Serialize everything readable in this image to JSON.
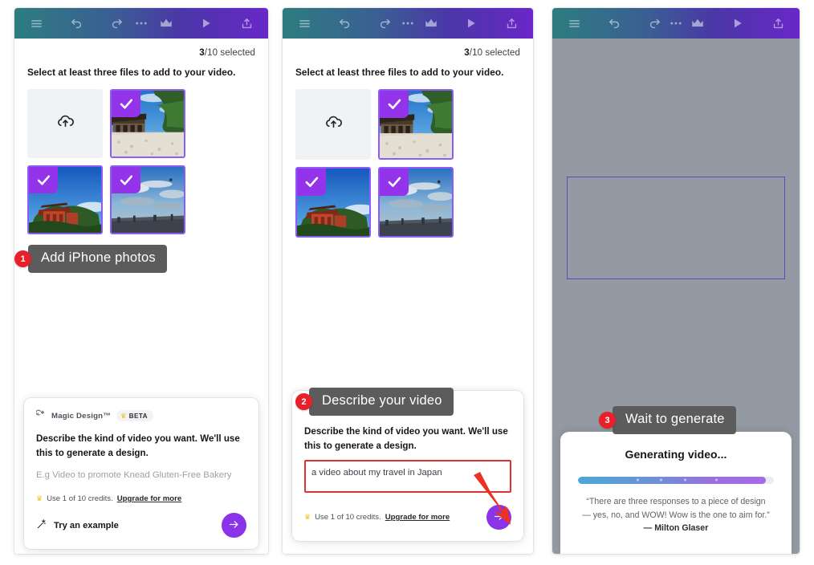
{
  "toolbar": {
    "icons": [
      {
        "name": "menu-icon",
        "label": "Menu"
      },
      {
        "name": "undo-icon",
        "label": "Undo"
      },
      {
        "name": "redo-icon",
        "label": "Redo"
      },
      {
        "name": "more-options-icon",
        "label": "More"
      },
      {
        "name": "crown-icon",
        "label": "Pro"
      },
      {
        "name": "play-icon",
        "label": "Play"
      },
      {
        "name": "share-icon",
        "label": "Share"
      }
    ]
  },
  "selection": {
    "count": "3",
    "count_suffix": "/10 selected",
    "hint": "Select at least three files to add to your video.",
    "upload_icon": "cloud-upload-icon",
    "photos": [
      {
        "name": "photo-japanese-temple",
        "selected": true
      },
      {
        "name": "photo-red-shrine-gate",
        "selected": true
      },
      {
        "name": "photo-cloudy-city-sky",
        "selected": true
      }
    ]
  },
  "magic": {
    "brand": "Magic Design™",
    "badge": "BETA",
    "badge_icon": "crown-icon",
    "brand_icon": "magic-sparkle-icon",
    "description": "Describe the kind of video you want. We'll use this to generate a design.",
    "placeholder": "E.g Video to promote Knead Gluten-Free Bakery",
    "value": "a video about my travel in Japan",
    "credits_prefix": "Use 1 of 10 credits.",
    "credits_link": "Upgrade for more",
    "credits_icon": "crown-icon",
    "try_example": "Try an example",
    "try_example_icon": "sparkle-wand-icon",
    "submit_icon": "arrow-right-icon"
  },
  "generating": {
    "title": "Generating video...",
    "progress_percent": 96,
    "quote_line1": "“There are three responses to a piece of design",
    "quote_line2": "— yes, no, and WOW! Wow is the one to aim for.”",
    "author": "— Milton Glaser"
  },
  "callouts": [
    {
      "number": "1",
      "text": "Add iPhone photos"
    },
    {
      "number": "2",
      "text": "Describe your video"
    },
    {
      "number": "3",
      "text": "Wait to generate"
    }
  ],
  "colors": {
    "accent_purple": "#8b33e8",
    "select_purple": "#9333ea",
    "callout_red": "#e8202a",
    "annotation_red": "#e03030",
    "callout_gray": "#5c5c5c",
    "toolbar_gradient_start": "#2d7d80",
    "toolbar_gradient_end": "#6927c8"
  }
}
